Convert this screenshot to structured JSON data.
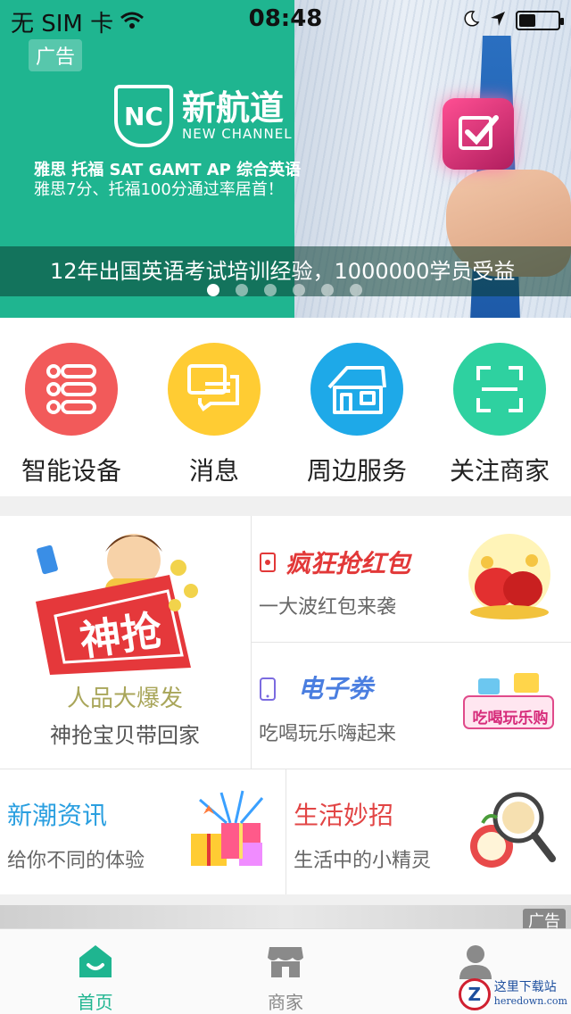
{
  "status_bar": {
    "carrier": "无 SIM 卡",
    "time": "08:48",
    "icons": [
      "wifi-icon",
      "moon-icon",
      "location-arrow-icon",
      "battery-icon"
    ]
  },
  "banner": {
    "ad_tag": "广告",
    "logo_cn": "新航道",
    "logo_en": "NEW CHANNEL",
    "logo_mark": "NC",
    "line1": "雅思 托福 SAT GAMT AP 综合英语",
    "line2": "雅思7分、托福100分通过率居首！",
    "caption": "12年出国英语考试培训经验，1000000学员受益",
    "carousel_total": 6,
    "carousel_active": 1,
    "colors": {
      "bg": "#1fb590"
    }
  },
  "quick_entries": [
    {
      "label": "智能设备",
      "icon": "list-icon",
      "color": "#f25a5a"
    },
    {
      "label": "消息",
      "icon": "chat-icon",
      "color": "#ffcc33"
    },
    {
      "label": "周边服务",
      "icon": "house-icon",
      "color": "#1ea9e8"
    },
    {
      "label": "关注商家",
      "icon": "scan-icon",
      "color": "#2ed1a0"
    }
  ],
  "promo": {
    "shenqiang": {
      "badge": "神抢",
      "title": "人品大爆发",
      "subtitle": "神抢宝贝带回家"
    },
    "red_packet": {
      "title": "疯狂抢红包",
      "subtitle": "一大波红包来袭"
    },
    "coupon": {
      "title": "电子劵",
      "subtitle": "吃喝玩乐嗨起来",
      "tag_text": "吃喝玩乐购"
    },
    "news": {
      "title": "新潮资讯",
      "subtitle": "给你不同的体验"
    },
    "life": {
      "title": "生活妙招",
      "subtitle": "生活中的小精灵"
    }
  },
  "strip": {
    "ad_tag": "广告"
  },
  "tabbar": {
    "tabs": [
      {
        "label": "首页",
        "icon": "home-icon",
        "active": true
      },
      {
        "label": "商家",
        "icon": "shop-icon",
        "active": false
      },
      {
        "label": "",
        "icon": "user-icon",
        "active": false
      }
    ],
    "active_color": "#1fb590"
  },
  "watermark": {
    "line1": "这里下载站",
    "line2": "heredown.com",
    "mark": "Z"
  }
}
